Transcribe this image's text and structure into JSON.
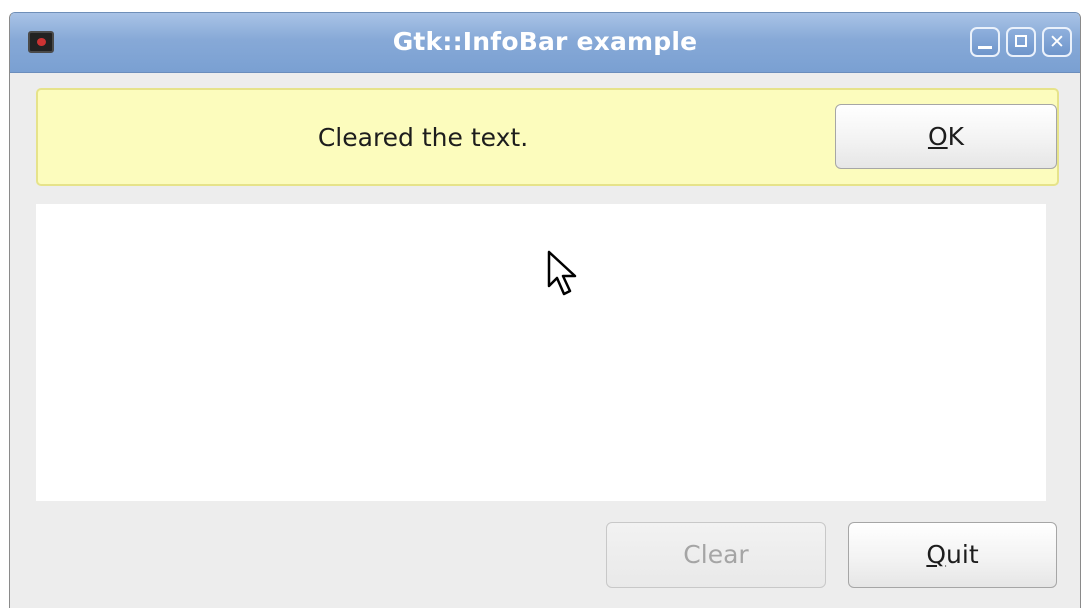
{
  "window": {
    "title": "Gtk::InfoBar example",
    "buttons": [
      "minimize-icon",
      "maximize-icon",
      "close-icon"
    ]
  },
  "infobar": {
    "message": "Cleared the text.",
    "ok_button": {
      "mnemonic": "O",
      "rest": "K"
    },
    "color": "#fcfcbd"
  },
  "text_area": {
    "value": ""
  },
  "footer": {
    "clear_button": "Clear",
    "quit_button": {
      "mnemonic": "Q",
      "rest": "uit"
    }
  },
  "colors": {
    "titlebar": "#87a9d7",
    "window_bg": "#ededed",
    "disabled_text": "#a5a5a5"
  }
}
